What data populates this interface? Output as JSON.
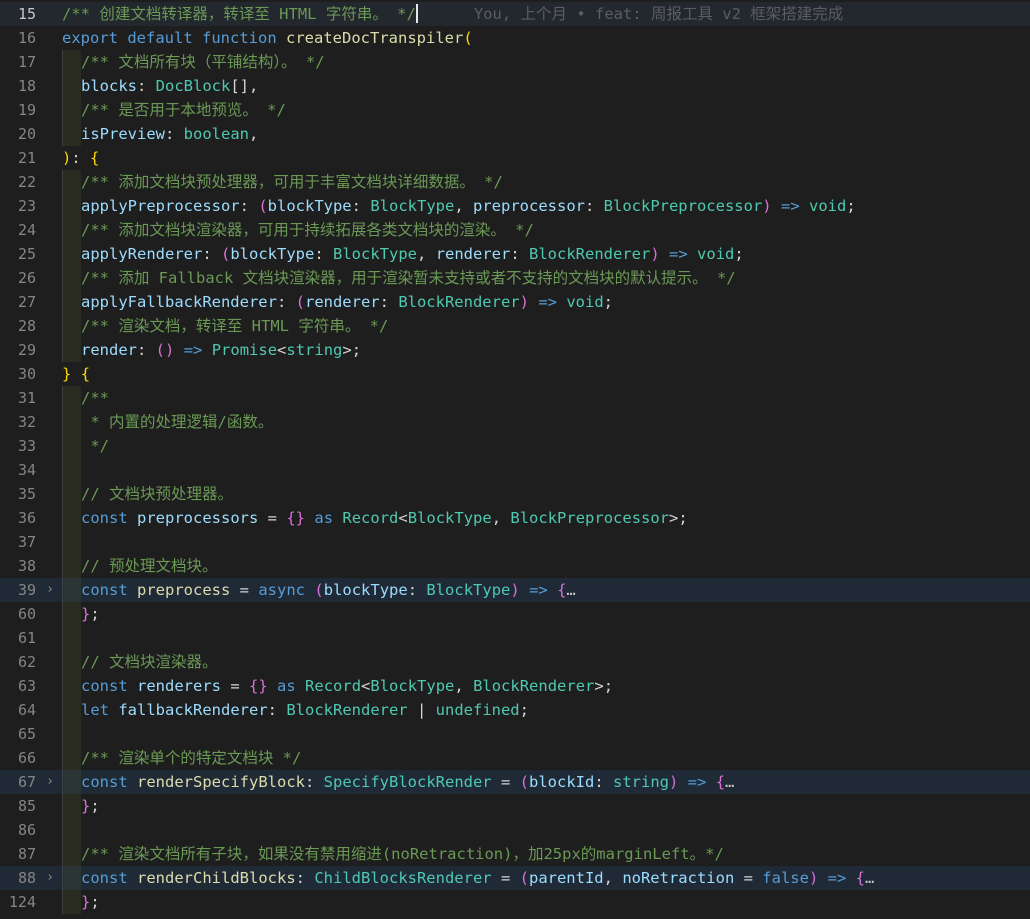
{
  "editor": {
    "blame_annotation": "You, 上个月 • feat: 周报工具 v2 框架搭建完成",
    "current_line": "15",
    "colors": {
      "background": "#1e1e1e",
      "comment": "#6a9955",
      "keyword": "#569cd6",
      "function": "#dcdcaa",
      "type": "#4ec9b0",
      "variable": "#9cdcfe",
      "bracket_1": "#ffd700",
      "bracket_2": "#da70d6",
      "bracket_3": "#179fff"
    },
    "lines": [
      {
        "no": "15",
        "indent": 0,
        "current": true,
        "caret_after": true,
        "tokens": [
          {
            "t": "com",
            "v": "/** 创建文档转译器，转译至 HTML 字符串。 */"
          }
        ]
      },
      {
        "no": "16",
        "indent": 0,
        "tokens": [
          {
            "t": "kw",
            "v": "export"
          },
          {
            "t": "op",
            "v": " "
          },
          {
            "t": "kw",
            "v": "default"
          },
          {
            "t": "op",
            "v": " "
          },
          {
            "t": "kw",
            "v": "function"
          },
          {
            "t": "op",
            "v": " "
          },
          {
            "t": "fn",
            "v": "createDocTranspiler"
          },
          {
            "t": "br1",
            "v": "("
          }
        ]
      },
      {
        "no": "17",
        "indent": 1,
        "tokens": [
          {
            "t": "com",
            "v": "/** 文档所有块（平铺结构）。 */"
          }
        ]
      },
      {
        "no": "18",
        "indent": 1,
        "tokens": [
          {
            "t": "id",
            "v": "blocks"
          },
          {
            "t": "op",
            "v": ": "
          },
          {
            "t": "type",
            "v": "DocBlock"
          },
          {
            "t": "op",
            "v": "[]"
          },
          {
            "t": "punc",
            "v": ","
          }
        ]
      },
      {
        "no": "19",
        "indent": 1,
        "tokens": [
          {
            "t": "com",
            "v": "/** 是否用于本地预览。 */"
          }
        ]
      },
      {
        "no": "20",
        "indent": 1,
        "tokens": [
          {
            "t": "id",
            "v": "isPreview"
          },
          {
            "t": "op",
            "v": ": "
          },
          {
            "t": "type",
            "v": "boolean"
          },
          {
            "t": "punc",
            "v": ","
          }
        ]
      },
      {
        "no": "21",
        "indent": 0,
        "tokens": [
          {
            "t": "br1",
            "v": ")"
          },
          {
            "t": "op",
            "v": ": "
          },
          {
            "t": "br1",
            "v": "{"
          }
        ]
      },
      {
        "no": "22",
        "indent": 1,
        "tokens": [
          {
            "t": "com",
            "v": "/** 添加文档块预处理器，可用于丰富文档块详细数据。 */"
          }
        ]
      },
      {
        "no": "23",
        "indent": 1,
        "tokens": [
          {
            "t": "id",
            "v": "applyPreprocessor"
          },
          {
            "t": "op",
            "v": ": "
          },
          {
            "t": "br2",
            "v": "("
          },
          {
            "t": "id",
            "v": "blockType"
          },
          {
            "t": "op",
            "v": ": "
          },
          {
            "t": "type",
            "v": "BlockType"
          },
          {
            "t": "punc",
            "v": ", "
          },
          {
            "t": "id",
            "v": "preprocessor"
          },
          {
            "t": "op",
            "v": ": "
          },
          {
            "t": "type",
            "v": "BlockPreprocessor"
          },
          {
            "t": "br2",
            "v": ")"
          },
          {
            "t": "op",
            "v": " "
          },
          {
            "t": "kw",
            "v": "=>"
          },
          {
            "t": "op",
            "v": " "
          },
          {
            "t": "type",
            "v": "void"
          },
          {
            "t": "punc",
            "v": ";"
          }
        ]
      },
      {
        "no": "24",
        "indent": 1,
        "tokens": [
          {
            "t": "com",
            "v": "/** 添加文档块渲染器，可用于持续拓展各类文档块的渲染。 */"
          }
        ]
      },
      {
        "no": "25",
        "indent": 1,
        "tokens": [
          {
            "t": "id",
            "v": "applyRenderer"
          },
          {
            "t": "op",
            "v": ": "
          },
          {
            "t": "br2",
            "v": "("
          },
          {
            "t": "id",
            "v": "blockType"
          },
          {
            "t": "op",
            "v": ": "
          },
          {
            "t": "type",
            "v": "BlockType"
          },
          {
            "t": "punc",
            "v": ", "
          },
          {
            "t": "id",
            "v": "renderer"
          },
          {
            "t": "op",
            "v": ": "
          },
          {
            "t": "type",
            "v": "BlockRenderer"
          },
          {
            "t": "br2",
            "v": ")"
          },
          {
            "t": "op",
            "v": " "
          },
          {
            "t": "kw",
            "v": "=>"
          },
          {
            "t": "op",
            "v": " "
          },
          {
            "t": "type",
            "v": "void"
          },
          {
            "t": "punc",
            "v": ";"
          }
        ]
      },
      {
        "no": "26",
        "indent": 1,
        "tokens": [
          {
            "t": "com",
            "v": "/** 添加 Fallback 文档块渲染器，用于渲染暂未支持或者不支持的文档块的默认提示。 */"
          }
        ]
      },
      {
        "no": "27",
        "indent": 1,
        "tokens": [
          {
            "t": "id",
            "v": "applyFallbackRenderer"
          },
          {
            "t": "op",
            "v": ": "
          },
          {
            "t": "br2",
            "v": "("
          },
          {
            "t": "id",
            "v": "renderer"
          },
          {
            "t": "op",
            "v": ": "
          },
          {
            "t": "type",
            "v": "BlockRenderer"
          },
          {
            "t": "br2",
            "v": ")"
          },
          {
            "t": "op",
            "v": " "
          },
          {
            "t": "kw",
            "v": "=>"
          },
          {
            "t": "op",
            "v": " "
          },
          {
            "t": "type",
            "v": "void"
          },
          {
            "t": "punc",
            "v": ";"
          }
        ]
      },
      {
        "no": "28",
        "indent": 1,
        "tokens": [
          {
            "t": "com",
            "v": "/** 渲染文档，转译至 HTML 字符串。 */"
          }
        ]
      },
      {
        "no": "29",
        "indent": 1,
        "tokens": [
          {
            "t": "id",
            "v": "render"
          },
          {
            "t": "op",
            "v": ": "
          },
          {
            "t": "br2",
            "v": "()"
          },
          {
            "t": "op",
            "v": " "
          },
          {
            "t": "kw",
            "v": "=>"
          },
          {
            "t": "op",
            "v": " "
          },
          {
            "t": "type",
            "v": "Promise"
          },
          {
            "t": "op",
            "v": "<"
          },
          {
            "t": "type",
            "v": "string"
          },
          {
            "t": "op",
            "v": ">"
          },
          {
            "t": "punc",
            "v": ";"
          }
        ]
      },
      {
        "no": "30",
        "indent": 0,
        "tokens": [
          {
            "t": "br1",
            "v": "}"
          },
          {
            "t": "op",
            "v": " "
          },
          {
            "t": "br1",
            "v": "{"
          }
        ]
      },
      {
        "no": "31",
        "indent": 1,
        "tokens": [
          {
            "t": "com",
            "v": "/**"
          }
        ]
      },
      {
        "no": "32",
        "indent": 1,
        "tokens": [
          {
            "t": "com",
            "v": " * 内置的处理逻辑/函数。"
          }
        ]
      },
      {
        "no": "33",
        "indent": 1,
        "tokens": [
          {
            "t": "com",
            "v": " */"
          }
        ]
      },
      {
        "no": "34",
        "indent": 1,
        "tokens": []
      },
      {
        "no": "35",
        "indent": 1,
        "tokens": [
          {
            "t": "com",
            "v": "// 文档块预处理器。"
          }
        ]
      },
      {
        "no": "36",
        "indent": 1,
        "tokens": [
          {
            "t": "kw",
            "v": "const"
          },
          {
            "t": "op",
            "v": " "
          },
          {
            "t": "id",
            "v": "preprocessors"
          },
          {
            "t": "op",
            "v": " = "
          },
          {
            "t": "br2",
            "v": "{}"
          },
          {
            "t": "op",
            "v": " "
          },
          {
            "t": "kw",
            "v": "as"
          },
          {
            "t": "op",
            "v": " "
          },
          {
            "t": "type",
            "v": "Record"
          },
          {
            "t": "op",
            "v": "<"
          },
          {
            "t": "type",
            "v": "BlockType"
          },
          {
            "t": "punc",
            "v": ", "
          },
          {
            "t": "type",
            "v": "BlockPreprocessor"
          },
          {
            "t": "op",
            "v": ">"
          },
          {
            "t": "punc",
            "v": ";"
          }
        ]
      },
      {
        "no": "37",
        "indent": 1,
        "tokens": []
      },
      {
        "no": "38",
        "indent": 1,
        "tokens": [
          {
            "t": "com",
            "v": "// 预处理文档块。"
          }
        ]
      },
      {
        "no": "39",
        "indent": 1,
        "folded": true,
        "tokens": [
          {
            "t": "kw",
            "v": "const"
          },
          {
            "t": "op",
            "v": " "
          },
          {
            "t": "fn",
            "v": "preprocess"
          },
          {
            "t": "op",
            "v": " = "
          },
          {
            "t": "kw",
            "v": "async"
          },
          {
            "t": "op",
            "v": " "
          },
          {
            "t": "br2",
            "v": "("
          },
          {
            "t": "id",
            "v": "blockType"
          },
          {
            "t": "op",
            "v": ": "
          },
          {
            "t": "type",
            "v": "BlockType"
          },
          {
            "t": "br2",
            "v": ")"
          },
          {
            "t": "op",
            "v": " "
          },
          {
            "t": "kw",
            "v": "=>"
          },
          {
            "t": "op",
            "v": " "
          },
          {
            "t": "br2",
            "v": "{"
          },
          {
            "t": "ell",
            "v": "…"
          }
        ]
      },
      {
        "no": "60",
        "indent": 1,
        "tokens": [
          {
            "t": "br2",
            "v": "}"
          },
          {
            "t": "punc",
            "v": ";"
          }
        ]
      },
      {
        "no": "61",
        "indent": 1,
        "tokens": []
      },
      {
        "no": "62",
        "indent": 1,
        "tokens": [
          {
            "t": "com",
            "v": "// 文档块渲染器。"
          }
        ]
      },
      {
        "no": "63",
        "indent": 1,
        "tokens": [
          {
            "t": "kw",
            "v": "const"
          },
          {
            "t": "op",
            "v": " "
          },
          {
            "t": "id",
            "v": "renderers"
          },
          {
            "t": "op",
            "v": " = "
          },
          {
            "t": "br2",
            "v": "{}"
          },
          {
            "t": "op",
            "v": " "
          },
          {
            "t": "kw",
            "v": "as"
          },
          {
            "t": "op",
            "v": " "
          },
          {
            "t": "type",
            "v": "Record"
          },
          {
            "t": "op",
            "v": "<"
          },
          {
            "t": "type",
            "v": "BlockType"
          },
          {
            "t": "punc",
            "v": ", "
          },
          {
            "t": "type",
            "v": "BlockRenderer"
          },
          {
            "t": "op",
            "v": ">"
          },
          {
            "t": "punc",
            "v": ";"
          }
        ]
      },
      {
        "no": "64",
        "indent": 1,
        "tokens": [
          {
            "t": "kw",
            "v": "let"
          },
          {
            "t": "op",
            "v": " "
          },
          {
            "t": "id",
            "v": "fallbackRenderer"
          },
          {
            "t": "op",
            "v": ": "
          },
          {
            "t": "type",
            "v": "BlockRenderer"
          },
          {
            "t": "op",
            "v": " | "
          },
          {
            "t": "type",
            "v": "undefined"
          },
          {
            "t": "punc",
            "v": ";"
          }
        ]
      },
      {
        "no": "65",
        "indent": 1,
        "tokens": []
      },
      {
        "no": "66",
        "indent": 1,
        "tokens": [
          {
            "t": "com",
            "v": "/** 渲染单个的特定文档块 */"
          }
        ]
      },
      {
        "no": "67",
        "indent": 1,
        "folded": true,
        "tokens": [
          {
            "t": "kw",
            "v": "const"
          },
          {
            "t": "op",
            "v": " "
          },
          {
            "t": "fn",
            "v": "renderSpecifyBlock"
          },
          {
            "t": "op",
            "v": ": "
          },
          {
            "t": "type",
            "v": "SpecifyBlockRender"
          },
          {
            "t": "op",
            "v": " = "
          },
          {
            "t": "br2",
            "v": "("
          },
          {
            "t": "id",
            "v": "blockId"
          },
          {
            "t": "op",
            "v": ": "
          },
          {
            "t": "type",
            "v": "string"
          },
          {
            "t": "br2",
            "v": ")"
          },
          {
            "t": "op",
            "v": " "
          },
          {
            "t": "kw",
            "v": "=>"
          },
          {
            "t": "op",
            "v": " "
          },
          {
            "t": "br2",
            "v": "{"
          },
          {
            "t": "ell",
            "v": "…"
          }
        ]
      },
      {
        "no": "85",
        "indent": 1,
        "tokens": [
          {
            "t": "br2",
            "v": "}"
          },
          {
            "t": "punc",
            "v": ";"
          }
        ]
      },
      {
        "no": "86",
        "indent": 1,
        "tokens": []
      },
      {
        "no": "87",
        "indent": 1,
        "tokens": [
          {
            "t": "com",
            "v": "/** 渲染文档所有子块，如果没有禁用缩进(noRetraction)，加25px的marginLeft。*/"
          }
        ]
      },
      {
        "no": "88",
        "indent": 1,
        "folded": true,
        "tokens": [
          {
            "t": "kw",
            "v": "const"
          },
          {
            "t": "op",
            "v": " "
          },
          {
            "t": "fn",
            "v": "renderChildBlocks"
          },
          {
            "t": "op",
            "v": ": "
          },
          {
            "t": "type",
            "v": "ChildBlocksRenderer"
          },
          {
            "t": "op",
            "v": " = "
          },
          {
            "t": "br2",
            "v": "("
          },
          {
            "t": "id",
            "v": "parentId"
          },
          {
            "t": "punc",
            "v": ", "
          },
          {
            "t": "id",
            "v": "noRetraction"
          },
          {
            "t": "op",
            "v": " = "
          },
          {
            "t": "lit",
            "v": "false"
          },
          {
            "t": "br2",
            "v": ")"
          },
          {
            "t": "op",
            "v": " "
          },
          {
            "t": "kw",
            "v": "=>"
          },
          {
            "t": "op",
            "v": " "
          },
          {
            "t": "br2",
            "v": "{"
          },
          {
            "t": "ell",
            "v": "…"
          }
        ]
      },
      {
        "no": "124",
        "indent": 1,
        "tokens": [
          {
            "t": "br2",
            "v": "}"
          },
          {
            "t": "punc",
            "v": ";"
          }
        ]
      }
    ]
  }
}
